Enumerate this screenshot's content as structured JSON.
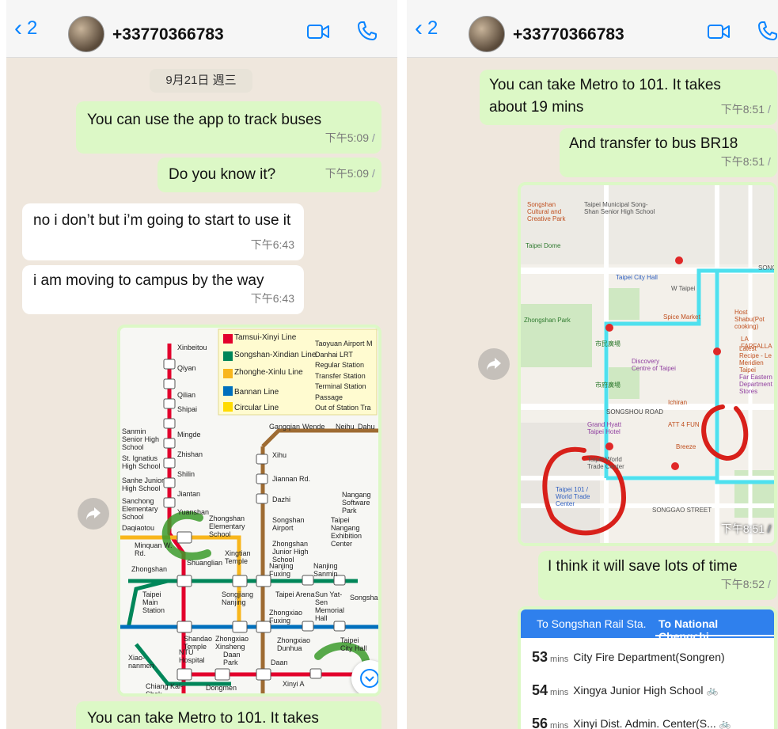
{
  "header": {
    "back_count": "2",
    "contact": "+33770366783"
  },
  "left": {
    "date_pill": "9月21日 週三",
    "messages": [
      {
        "text": "You can use the app to track buses",
        "time": "下午5:09"
      },
      {
        "text": "Do you know it?",
        "time": "下午5:09"
      },
      {
        "text": "no i don’t but i’m going to start to use it",
        "time": "下午6:43"
      },
      {
        "text": "i am moving to campus by the way",
        "time": "下午6:43"
      },
      {
        "text": "You can take Metro to 101. It takes"
      }
    ],
    "metro_map": {
      "stations": [
        "Xinbeitou",
        "Qiyan",
        "Qilian",
        "Shipai",
        "Mingde",
        "Zhishan",
        "Shilin",
        "Jiantan",
        "Yuanshan",
        "Minquan W. Rd.",
        "Shuanglian",
        "Zhongshan",
        "Taipei Main Station",
        "Shandao Temple",
        "NTU Hospital",
        "Chiang Kai-Shek",
        "Dongmen",
        "Daan Park",
        "Daan",
        "Xinyi A",
        "Songjiang Nanjing",
        "Xingtian Temple",
        "Zhongshan Elementary School",
        "Songshan Airport",
        "Zhongshan Junior High School",
        "Nanjing Fuxing",
        "Nanjing Sanmin",
        "Zhongxiao Fuxing",
        "Zhongxiao Dunhua",
        "Sun Yat-Sen Memorial Hall",
        "Taipei City Hall",
        "Taipei Arena",
        "Songshan",
        "Dazhi",
        "Jiannan Rd.",
        "Xihu",
        "Gangqian",
        "Wende",
        "Neihu",
        "Dahu",
        "Zhongxiao Xinsheng",
        "Xiao-nanmen",
        "Sanmin Senior High School",
        "St. Ignatius High School",
        "Sanhe Junior High School",
        "Sanchong Elementary School",
        "Daqiaotou",
        "Taipei Nangang Exhibition Center",
        "Nangang Software Park"
      ],
      "legend": [
        {
          "code": "R",
          "label": "Tamsui-Xinyi Line",
          "color": "#e3002c"
        },
        {
          "code": "G",
          "label": "Songshan-Xindian Line",
          "color": "#008659"
        },
        {
          "code": "O",
          "label": "Zhonghe-Xinlu Line",
          "color": "#f8b61c"
        },
        {
          "code": "BL",
          "label": "Bannan Line",
          "color": "#0070bd"
        },
        {
          "code": "Y",
          "label": "Circular Line",
          "color": "#ffdb00"
        }
      ],
      "legend_right": [
        "Taoyuan Airport M",
        "Danhai LRT",
        "Regular Station",
        "Transfer Station",
        "Terminal Station",
        "Passage",
        "Out of Station Tra"
      ]
    }
  },
  "right": {
    "messages": [
      {
        "text": "You can take Metro to 101. It takes about 19 mins",
        "time": "下午8:51"
      },
      {
        "text": "And transfer to bus BR18",
        "time": "下午8:51"
      },
      {
        "text": "I think it will save lots of time",
        "time": "下午8:52"
      }
    ],
    "street_map": {
      "time": "下午8:51",
      "labels": [
        "Songshan Cultural and Creative Park",
        "Taipei Municipal Song-Shan Senior High School",
        "Taipei Dome",
        "Taipei City Hall",
        "W Taipei",
        "Zhongshan Park",
        "Spice Market",
        "Host Shabu(Pot cooking)",
        "LA FARFALLA",
        "Latest Recipe - Le Meridien Taipei",
        "Discovery Centre of Taipei",
        "Far Eastern Department Stores",
        "Ichiran",
        "SONGSHOU ROAD",
        "Grand Hyatt Taipei Hotel",
        "ATT 4 FUN",
        "Breeze",
        "Taipei World Trade Center",
        "Taipei 101 / World Trade Center",
        "SONGGAO STREET",
        "SONGRENROAD",
        "市民廣場",
        "市府廣場"
      ]
    },
    "bus": {
      "tabs": [
        "To Songshan Rail Sta.",
        "To National Chengchi..."
      ],
      "rows": [
        {
          "mins": "53",
          "unit": "mins",
          "stop": "City Fire Department(Songren)"
        },
        {
          "mins": "54",
          "unit": "mins",
          "stop": "Xingya Junior High School"
        },
        {
          "mins": "56",
          "unit": "mins",
          "stop": "Xinyi Dist. Admin. Center(S..."
        }
      ]
    }
  },
  "colors": {
    "accent": "#0a84ff",
    "outgoing": "#dcf8c6",
    "incoming": "#ffffff",
    "chat_bg": "#efe7dd"
  }
}
